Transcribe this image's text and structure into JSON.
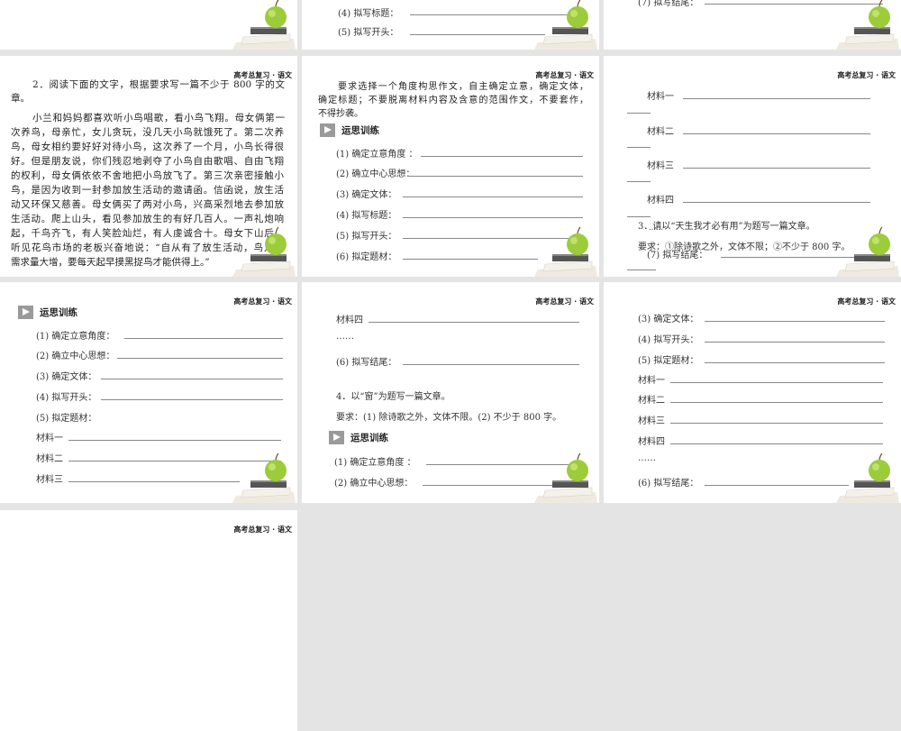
{
  "header": "高考总复习 · 语文",
  "section": "运思训练",
  "slide1": {
    "l4": "(4) 拟写标题：",
    "l5": "(5) 拟写开头："
  },
  "slide2": {
    "l7": "(7) 拟写结尾："
  },
  "slide3": {
    "lines": [
      "2．阅读下面的文字，根据要求写一篇不少于 800 字的文",
      "章。",
      "小兰和妈妈都喜欢听小鸟唱歌，看小鸟飞翔。母女俩第一",
      "次养鸟，母亲忙，女儿贪玩，没几天小鸟就饿死了。第二次养",
      "鸟，母女相约要好好对待小鸟，这次养了一个月，小鸟长得很",
      "好。但是朋友说，你们残忍地剥夺了小鸟自由歌唱、自由飞翔",
      "的权利，母女俩依依不舍地把小鸟放飞了。第三次亲密接触小",
      "鸟，是因为收到一封参加放生活动的邀请函。信函说，放生活",
      "动又环保又慈善。母女俩买了两对小鸟，兴高采烈地去参加放",
      "生活动。爬上山头，看见参加放生的有好几百人。一声礼炮响",
      "起，千鸟齐飞，有人笑脸灿烂，有人虔诚合十。母女下山后，",
      "听见花鸟市场的老板兴奋地说：“自从有了放生活动，鸟儿的",
      "需求量大增，要每天起早摸黑捉鸟才能供得上。”"
    ]
  },
  "slide4": {
    "intro": [
      "要求选择一个角度构思作文，自主确定立意，确定文体，",
      "确定标题；不要脱离材料内容及含意的范围作文，不要套作，",
      "不得抄袭。"
    ],
    "items": [
      "(1) 确定立意角度 ：",
      "(2) 确立中心思想：",
      "(3) 确定文体：",
      "(4) 拟写标题：",
      "(5) 拟写开头：",
      "(6) 拟定题材："
    ]
  },
  "slide5": {
    "m1": "材料一",
    "m2": "材料二",
    "m3": "材料三",
    "m4": "材料四",
    "q3": "3．请以“天生我才必有用”为题写一篇文章。",
    "dots": "……",
    "req": "要求：①除诗歌之外，文体不限；②不少于 800 字。",
    "l7": "(7) 拟写结尾："
  },
  "slide6": {
    "items": [
      "(1) 确定立意角度：",
      "(2) 确立中心思想：",
      "(3) 确定文体：",
      "(4) 拟写开头：",
      "(5) 拟定题材：",
      "材料一",
      "材料二",
      "材料三"
    ]
  },
  "slide7": {
    "m4": "材料四",
    "dots": "……",
    "l6": "(6) 拟写结尾：",
    "q4": "4．以“窗”为题写一篇文章。",
    "req": "要求：(1) 除诗歌之外，文体不限。(2) 不少于 800 字。",
    "i1": "(1) 确定立意角度 ：",
    "i2": "(2) 确立中心思想："
  },
  "slide8": {
    "items": [
      "(3) 确定文体：",
      "(4) 拟写开头：",
      "(5) 拟定题材：",
      "材料一",
      "材料二",
      "材料三",
      "材料四",
      "……",
      "(6) 拟写结尾："
    ]
  }
}
